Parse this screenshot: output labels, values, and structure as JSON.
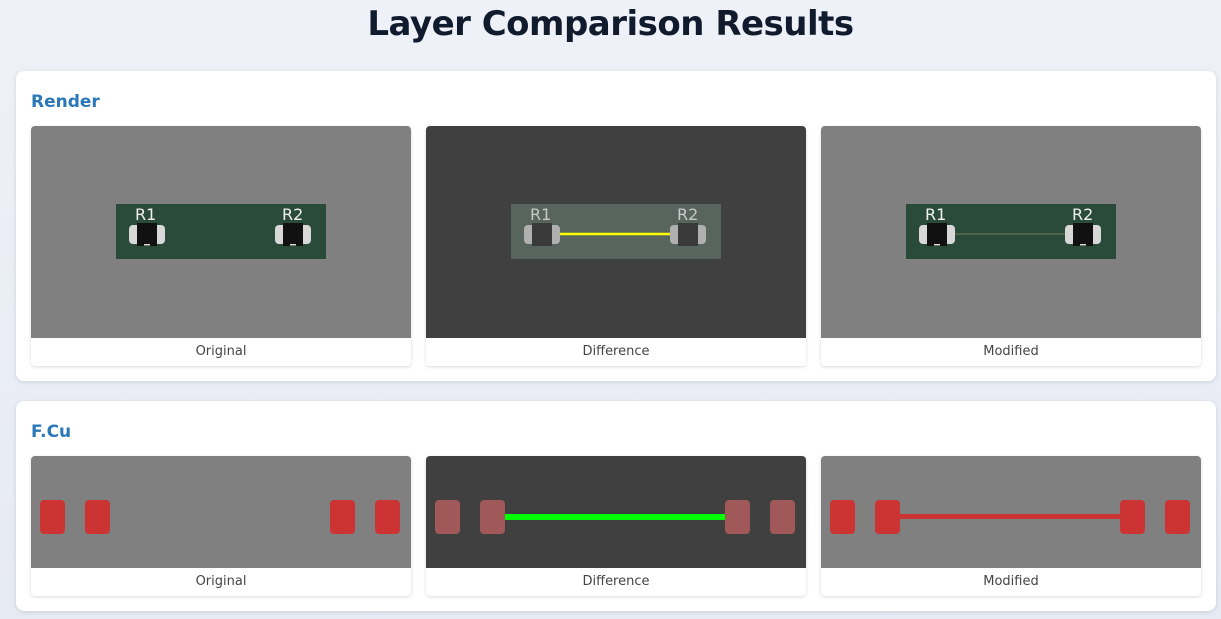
{
  "page": {
    "title": "Layer Comparison Results"
  },
  "colors": {
    "title": "#111b2e",
    "section_title": "#2a78b8",
    "panel_gray": "#808080",
    "panel_dark": "#404040",
    "board_green": "#2a4a3a",
    "pad_red": "#cc3333",
    "diff_green": "#00ff00",
    "diff_yellow": "#ffff00"
  },
  "sections": [
    {
      "title": "Render",
      "designators": [
        "R1",
        "R2"
      ],
      "panels": [
        {
          "caption": "Original"
        },
        {
          "caption": "Difference"
        },
        {
          "caption": "Modified"
        }
      ]
    },
    {
      "title": "F.Cu",
      "panels": [
        {
          "caption": "Original"
        },
        {
          "caption": "Difference"
        },
        {
          "caption": "Modified"
        }
      ]
    }
  ]
}
